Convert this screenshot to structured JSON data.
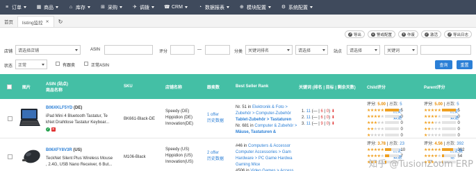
{
  "nav": [
    {
      "icon": "≡",
      "label": "订单"
    },
    {
      "icon": "▦",
      "label": "商品"
    },
    {
      "icon": "⌂",
      "label": "库存"
    },
    {
      "icon": "⊞",
      "label": "采购"
    },
    {
      "icon": "✈",
      "label": "调拨"
    },
    {
      "icon": "☎",
      "label": "CRM"
    },
    {
      "icon": "◔",
      "label": "数据报表"
    },
    {
      "icon": "⊕",
      "label": "模块配置"
    },
    {
      "icon": "⚙",
      "label": "系统配置"
    }
  ],
  "tabs": {
    "home": "首页",
    "active": "listing监控",
    "close": "✕",
    "refresh": "↻"
  },
  "actions": [
    "导出",
    "警戒配置",
    "作废",
    "激活",
    "导出日志"
  ],
  "filters": {
    "shop_label": "店铺",
    "shop_placeholder": "请选择店铺",
    "asin_label": "ASIN",
    "rating_label": "评分",
    "range_sep": "—",
    "category_label": "分类",
    "category_value": "关键词排名",
    "category_select": "请选择",
    "site_label": "站点",
    "site_select": "请选择",
    "keyword_select": "关键词",
    "status_label": "状态",
    "status_value": "正常",
    "has_follow": "有跟卖",
    "normal_asin": "正常ASIN",
    "query_btn": "查询",
    "reset_btn": "重置"
  },
  "columns": {
    "image": "图片",
    "asin_line1": "ASIN (站点)",
    "asin_line2": "商品名称",
    "sku": "SKU",
    "shop": "店铺名称",
    "follow": "跟卖数",
    "bsr": "Best Seller Rank",
    "keyword": "关键词 (排名 | 目标 | 剩余天数)",
    "child_rating": "Child评分",
    "parent_rating": "Parent评分"
  },
  "rows": [
    {
      "asin": "B06XKLF5YD",
      "site": "(DE)",
      "title1": "iPad Mini 4 Bluetooth Tastatur, Te",
      "title2": "kNet Drahtlose Tastatur Keyboar...",
      "sku": "BK661-Black-DE",
      "shops": [
        "Speedy (DE)",
        "Hippidion (DE)",
        "Innovation(DE)"
      ],
      "follow": "1 offer",
      "follow_hist": "历史数据",
      "bsr": [
        {
          "rank": "Nr. 51 in",
          "cat": "Elektronik & Foto >"
        },
        {
          "rank": "",
          "cat": "Zubehör > Computer-Zubehör"
        },
        {
          "rank": "",
          "cat": "Tablet-Zubehör > Tastaturen"
        },
        {
          "rank": "Nr. 681 in",
          "cat": "Computer & Zubehör >"
        },
        {
          "rank": "",
          "cat": "Mäuse, Tastaturen &"
        }
      ],
      "keywords": [
        {
          "idx": "1.",
          "rank": "11",
          "target": "6",
          "days": "0"
        },
        {
          "idx": "2.",
          "rank": "11",
          "target": "6",
          "days": "0"
        },
        {
          "idx": "3.",
          "rank": "11",
          "target": "9",
          "days": "0"
        }
      ],
      "child": {
        "score_label": "评分:",
        "score": "5.00",
        "total_label": "总数:",
        "total": "5",
        "history": "历史数据",
        "levels": [
          {
            "stars": 5,
            "count": "5",
            "fill": 1.0
          },
          {
            "stars": 4,
            "count": "0",
            "fill": 0
          },
          {
            "stars": 3,
            "count": "0",
            "fill": 0
          },
          {
            "stars": 2,
            "count": "0",
            "fill": 0
          },
          {
            "stars": 1,
            "count": "0",
            "fill": 0
          }
        ]
      },
      "parent": {
        "score_label": "评分:",
        "score": "5.00",
        "total_label": "总数:",
        "total": "5",
        "history": "历史数据",
        "levels": [
          {
            "stars": 5,
            "count": "5",
            "fill": 1.0
          },
          {
            "stars": 4,
            "count": "0",
            "fill": 0
          },
          {
            "stars": 3,
            "count": "0",
            "fill": 0
          },
          {
            "stars": 2,
            "count": "0",
            "fill": 0
          },
          {
            "stars": 1,
            "count": "0",
            "fill": 0
          }
        ]
      }
    },
    {
      "asin": "B06XFY8V3R",
      "site": "(US)",
      "title1": "TeckNet Silent Plus Wireless Mouse",
      "title2": ", 2.4G, USB Nano Receiver, 6 But...",
      "sku": "M106-Black",
      "shops": [
        "Speedy (US)",
        "Hippidion (US)",
        "Innovation(US)"
      ],
      "follow": "2 offer",
      "follow_hist": "历史数据",
      "bsr": [
        {
          "rank": "#46 in",
          "cat": "Computers & Accessor"
        },
        {
          "rank": "",
          "cat": "Computer Accessories > Gam"
        },
        {
          "rank": "",
          "cat": "Hardware > PC Game Hardwa"
        },
        {
          "rank": "",
          "cat": "Gaming Mice"
        },
        {
          "rank": "#506 in",
          "cat": "Video Games > Access"
        }
      ],
      "child": {
        "score_label": "评分:",
        "score": "3.78",
        "total_label": "总数:",
        "total": "23",
        "history": "历史数据",
        "levels": [
          {
            "stars": 5,
            "count": "10",
            "fill": 0.43
          },
          {
            "stars": 4,
            "count": "7",
            "fill": 0.3
          },
          {
            "stars": 3,
            "count": "",
            "fill": 0.1
          }
        ]
      },
      "parent": {
        "score_label": "评分:",
        "score": "4.56",
        "total_label": "总数:",
        "total": "392",
        "history": "历史数据",
        "levels": [
          {
            "stars": 5,
            "count": "302",
            "fill": 0.77
          },
          {
            "stars": 4,
            "count": "54",
            "fill": 0.14
          },
          {
            "stars": 3,
            "count": "",
            "fill": 0.05
          }
        ]
      }
    }
  ],
  "watermark": "知乎 @TusionZoom ERP"
}
